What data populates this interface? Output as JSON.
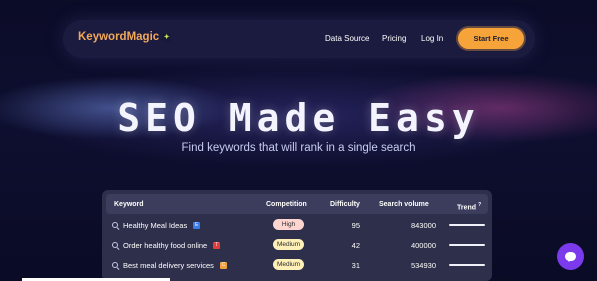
{
  "nav": {
    "logo": "KeywordMagic",
    "logo_icon": "sparkle-icon",
    "links": [
      "Data Source",
      "Pricing",
      "Log In"
    ],
    "cta_label": "Start Free",
    "cta_color": "#f6a43a"
  },
  "hero": {
    "title": "SEO Made Easy",
    "subtitle": "Find keywords that will rank in a single search"
  },
  "table": {
    "headers": {
      "keyword": "Keyword",
      "competition": "Competition",
      "difficulty": "Difficulty",
      "volume": "Search volume",
      "trend": "Trend",
      "trend_mark": "?"
    },
    "rows": [
      {
        "keyword": "Healthy Meal Ideas",
        "tag": "E",
        "tag_color": "#3a7be8",
        "competition": "High",
        "competition_color": "#ffd5d0",
        "difficulty": "95",
        "volume": "843000",
        "trend": 1.0
      },
      {
        "keyword": "Order healthy food online",
        "tag": "T",
        "tag_color": "#e23b3b",
        "competition": "Medium",
        "competition_color": "#fff0b8",
        "difficulty": "42",
        "volume": "400000",
        "trend": 1.0
      },
      {
        "keyword": "Best meal delivery services",
        "tag": "C",
        "tag_color": "#f0a23a",
        "competition": "Medium",
        "competition_color": "#fff0b8",
        "difficulty": "31",
        "volume": "534930",
        "trend": 1.0
      }
    ]
  },
  "chat": {
    "icon": "chat-icon",
    "color": "#7c3aed"
  }
}
